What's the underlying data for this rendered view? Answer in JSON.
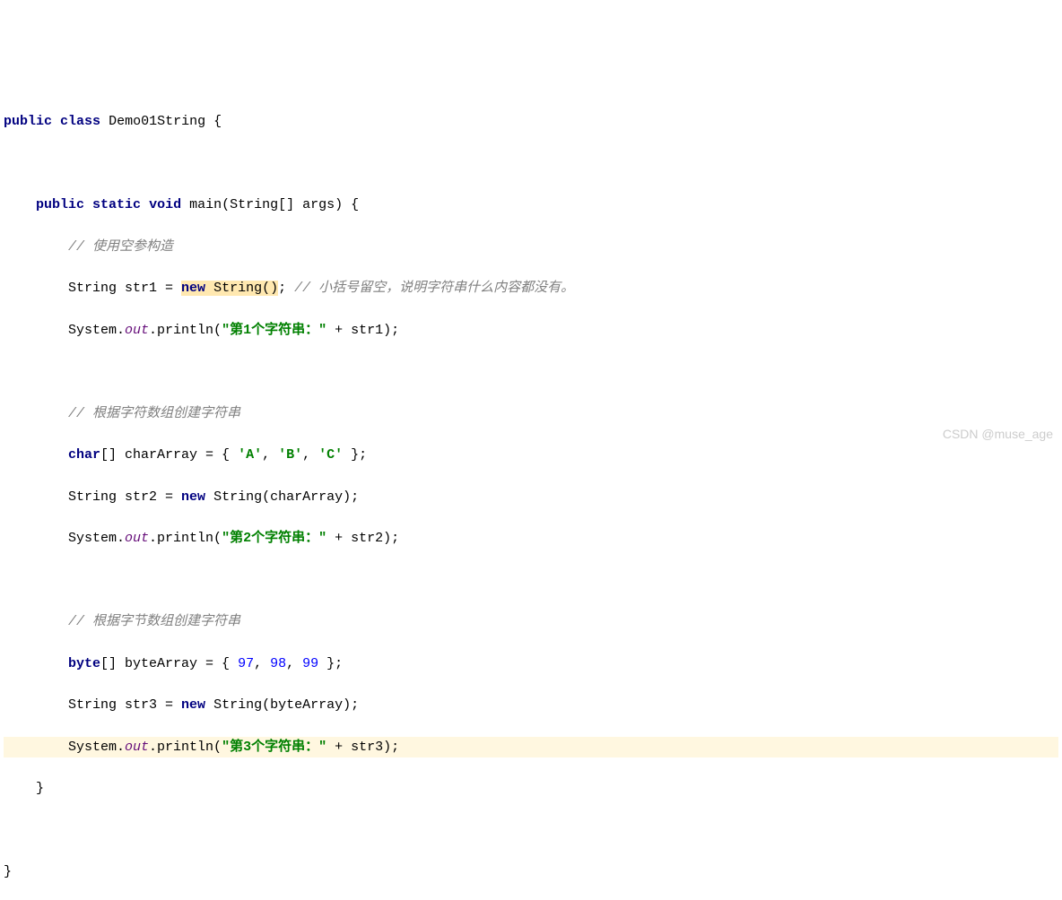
{
  "code": {
    "l1_public": "public",
    "l1_class": "class",
    "l1_name": "Demo01String",
    "l1_brace": " {",
    "l3_public": "public",
    "l3_static": "static",
    "l3_void": "void",
    "l3_main": "main(String[] args) {",
    "l4_c": "// 使用空参构造",
    "l5a": "String str1 = ",
    "l5_new": "new",
    "l5_sp": " ",
    "l5_string": "String()",
    "l5b": "; ",
    "l5_c": "// 小括号留空，说明字符串什么内容都没有。",
    "l6a": "System.",
    "l6_out": "out",
    "l6b": ".println(",
    "l6_str": "\"第1个字符串：\"",
    "l6c": " + str1);",
    "l8_c": "// 根据字符数组创建字符串",
    "l9_char": "char",
    "l9a": "[] charArray = { ",
    "l9_s1": "'A'",
    "l9_comma1": ", ",
    "l9_s2": "'B'",
    "l9_comma2": ", ",
    "l9_s3": "'C'",
    "l9b": " };",
    "l10a": "String str2 = ",
    "l10_new": "new",
    "l10b": " String(charArray);",
    "l11a": "System.",
    "l11_out": "out",
    "l11b": ".println(",
    "l11_str": "\"第2个字符串：\"",
    "l11c": " + str2);",
    "l13_c": "// 根据字节数组创建字符串",
    "l14_byte": "byte",
    "l14a": "[] byteArray = { ",
    "l14_n1": "97",
    "l14_comma1": ", ",
    "l14_n2": "98",
    "l14_comma2": ", ",
    "l14_n3": "99",
    "l14b": " };",
    "l15a": "String str3 = ",
    "l15_new": "new",
    "l15b": " String(byteArray);",
    "l16a": "System.",
    "l16_out": "out",
    "l16b": ".println(",
    "l16_str": "\"第3个字符串：\"",
    "l16c": " + str3);",
    "l17": "    }",
    "l19": "}"
  },
  "indent1": "    ",
  "indent2": "        ",
  "watermark": "CSDN @muse_age"
}
